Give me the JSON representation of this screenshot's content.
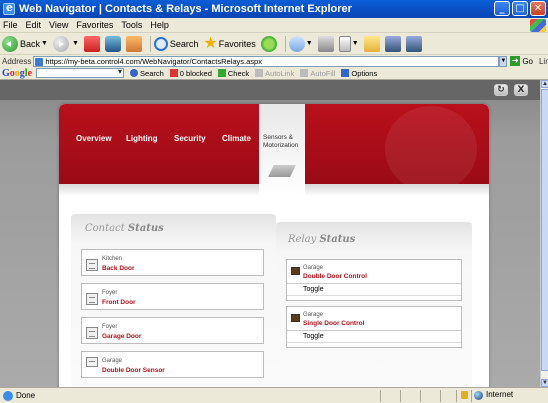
{
  "window": {
    "title": "Web Navigator | Contacts & Relays - Microsoft Internet Explorer",
    "minimize": "_",
    "maximize": "□",
    "close": "✕"
  },
  "menu": [
    "File",
    "Edit",
    "View",
    "Favorites",
    "Tools",
    "Help"
  ],
  "toolbar": {
    "back": "Back",
    "search": "Search",
    "favorites": "Favorites"
  },
  "address": {
    "label": "Address",
    "url": "https://my-beta.control4.com/WebNavigator/ContactsRelays.aspx",
    "go": "Go",
    "links": "Links"
  },
  "google": {
    "search": "Search",
    "blocked": "0 blocked",
    "check": "Check",
    "autolink": "AutoLink",
    "autofill": "AutoFill",
    "options": "Options"
  },
  "page": {
    "top_buttons": [
      "↻",
      "X"
    ],
    "nav": [
      "Overview",
      "Lighting",
      "Security",
      "Climate"
    ],
    "nav_active": "Sensors & Motorization",
    "contact": {
      "title_italic": "Contact",
      "title_bold": "Status",
      "items": [
        {
          "location": "Kitchen",
          "name": "Back Door"
        },
        {
          "location": "Foyer",
          "name": "Front Door"
        },
        {
          "location": "Foyer",
          "name": "Garage Door"
        },
        {
          "location": "Garage",
          "name": "Double Door Sensor"
        }
      ]
    },
    "relay": {
      "title_italic": "Relay",
      "title_bold": "Status",
      "items": [
        {
          "location": "Garage",
          "name": "Double Door Control",
          "action": "Toggle"
        },
        {
          "location": "Garage",
          "name": "Single Door Control",
          "action": "Toggle"
        }
      ]
    }
  },
  "status": {
    "text": "Done",
    "zone": "Internet"
  }
}
